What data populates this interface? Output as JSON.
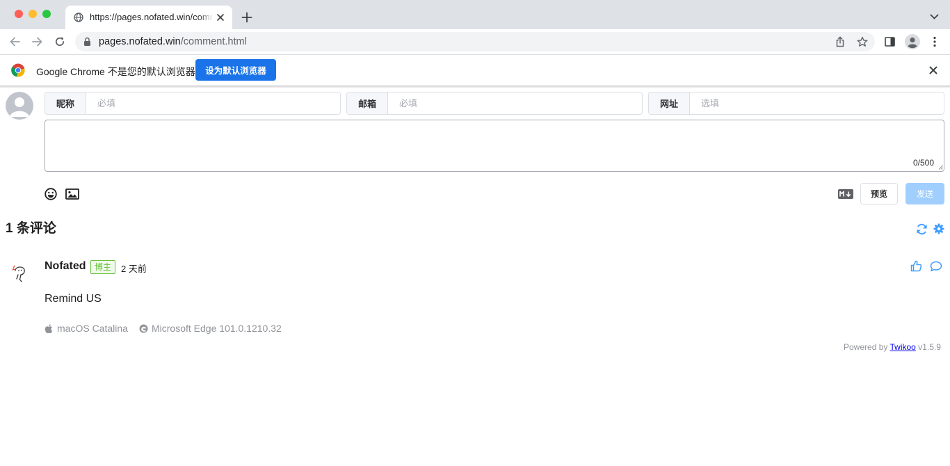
{
  "browser": {
    "tab_title": "https://pages.nofated.win/comment.html",
    "url_host": "pages.nofated.win",
    "url_path": "/comment.html",
    "infobar_text": "Google Chrome 不是您的默认浏览器",
    "infobar_button": "设为默认浏览器"
  },
  "form": {
    "fields": [
      {
        "label": "昵称",
        "placeholder": "必填"
      },
      {
        "label": "邮箱",
        "placeholder": "必填"
      },
      {
        "label": "网址",
        "placeholder": "选填"
      }
    ],
    "counter": "0/500",
    "preview_label": "预览",
    "send_label": "发送"
  },
  "comments_header": {
    "count_title": "1 条评论"
  },
  "comment": {
    "nick": "Nofated",
    "badge": "博主",
    "time": "2 天前",
    "content": "Remind US",
    "os": "macOS Catalina",
    "browser": "Microsoft Edge 101.0.1210.32"
  },
  "footer": {
    "powered_prefix": "Powered by",
    "powered_link": "Twikoo",
    "version": "v1.5.9"
  },
  "colors": {
    "accent": "#1a73e8",
    "twikoo_blue": "#409eff",
    "badge_green": "#67c23a"
  }
}
